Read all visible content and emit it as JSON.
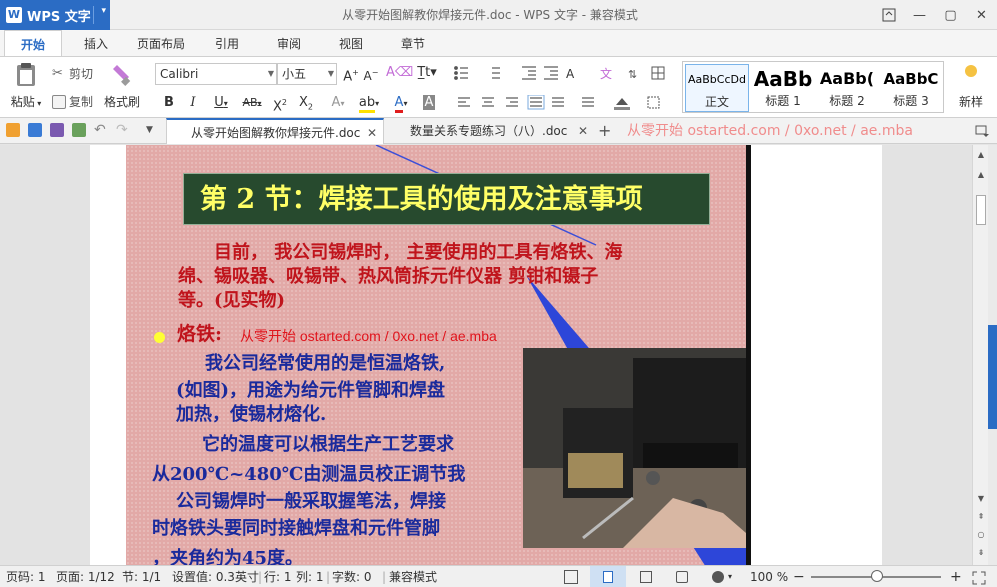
{
  "app": {
    "name": "WPS 文字",
    "window_title": "从零开始图解教你焊接元件.doc - WPS 文字 - 兼容模式"
  },
  "ribbon_tabs": [
    "开始",
    "插入",
    "页面布局",
    "引用",
    "审阅",
    "视图",
    "章节"
  ],
  "ribbon": {
    "paste": "粘贴",
    "cut": "剪切",
    "copy": "复制",
    "format_painter": "格式刷",
    "font_name": "Calibri",
    "font_size": "小五",
    "styles": [
      {
        "sample": "AaBbCcDd",
        "name": "正文"
      },
      {
        "sample": "AaBb",
        "name": "标题 1"
      },
      {
        "sample": "AaBb(",
        "name": "标题 2"
      },
      {
        "sample": "AaBbC",
        "name": "标题 3"
      }
    ],
    "new_style": "新样"
  },
  "doc_tabs": [
    {
      "label": "从零开始图解教你焊接元件.doc",
      "active": true
    },
    {
      "label": "数量关系专题练习（八）.doc",
      "active": false
    }
  ],
  "tab_watermark": "从零开始 ostarted.com / 0xo.net / ae.mba",
  "slide": {
    "title": "第 2 节：焊接工具的使用及注意事项",
    "intro_lines": [
      "　　目前， 我公司锡焊时， 主要使用的工具有烙铁、海",
      "绵、锡吸器、吸锡带、热风筒拆元件仪器 剪钳和镊子",
      "等。(见实物)"
    ],
    "section_label": "烙铁:",
    "inline_watermark": "从零开始 ostarted.com / 0xo.net / ae.mba",
    "body_lines": [
      "我公司经常使用的是恒温烙铁,",
      "(如图)，用途为给元件管脚和焊盘",
      "加热，使锡材熔化.",
      "它的温度可以根据生产工艺要求",
      "从200℃~480℃由测温员校正调节我",
      "公司锡焊时一般采取握笔法，焊接",
      "时烙铁头要同时接触焊盘和元件管脚",
      "，夹角约为45度。"
    ]
  },
  "status": {
    "page_num": "页码: 1",
    "pages": "页面: 1/12",
    "section": "节: 1/1",
    "setting": "设置值: 0.3英寸",
    "row": "行: 1",
    "col": "列: 1",
    "word_count": "字数: 0",
    "mode": "兼容模式",
    "zoom": "100 %"
  },
  "colors": {
    "accent": "#2b6cc4",
    "slide_bg": "#e2a9a7",
    "title_bg": "#274a2e",
    "title_text": "#ffff66",
    "red_text": "#c0141c",
    "blue_text": "#1a2a9c"
  }
}
